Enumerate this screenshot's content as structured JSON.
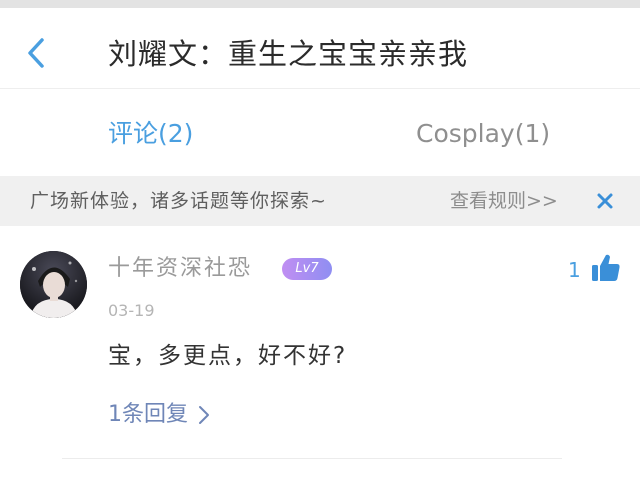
{
  "header": {
    "title": "刘耀文：重生之宝宝亲亲我",
    "back_icon": "chevron-left-icon"
  },
  "tabs": [
    {
      "label": "评论(2)",
      "active": true
    },
    {
      "label": "Cosplay(1)",
      "active": false
    }
  ],
  "notice": {
    "text": "广场新体验，诸多话题等你探索~",
    "link_label": "查看规则>>",
    "close_icon": "close-icon"
  },
  "comment": {
    "username": "十年资深社恐",
    "level": "Lv7",
    "likes": "1",
    "date": "03-19",
    "text": "宝，多更点，好不好?",
    "replies_label": "1条回复",
    "like_icon": "thumbs-up-icon",
    "avatar_icon": "avatar"
  },
  "colors": {
    "accent": "#4a9fe0",
    "badge_gradient_start": "#c08ef2",
    "badge_gradient_end": "#8f8ef2",
    "reply_link": "#6f86b7"
  }
}
